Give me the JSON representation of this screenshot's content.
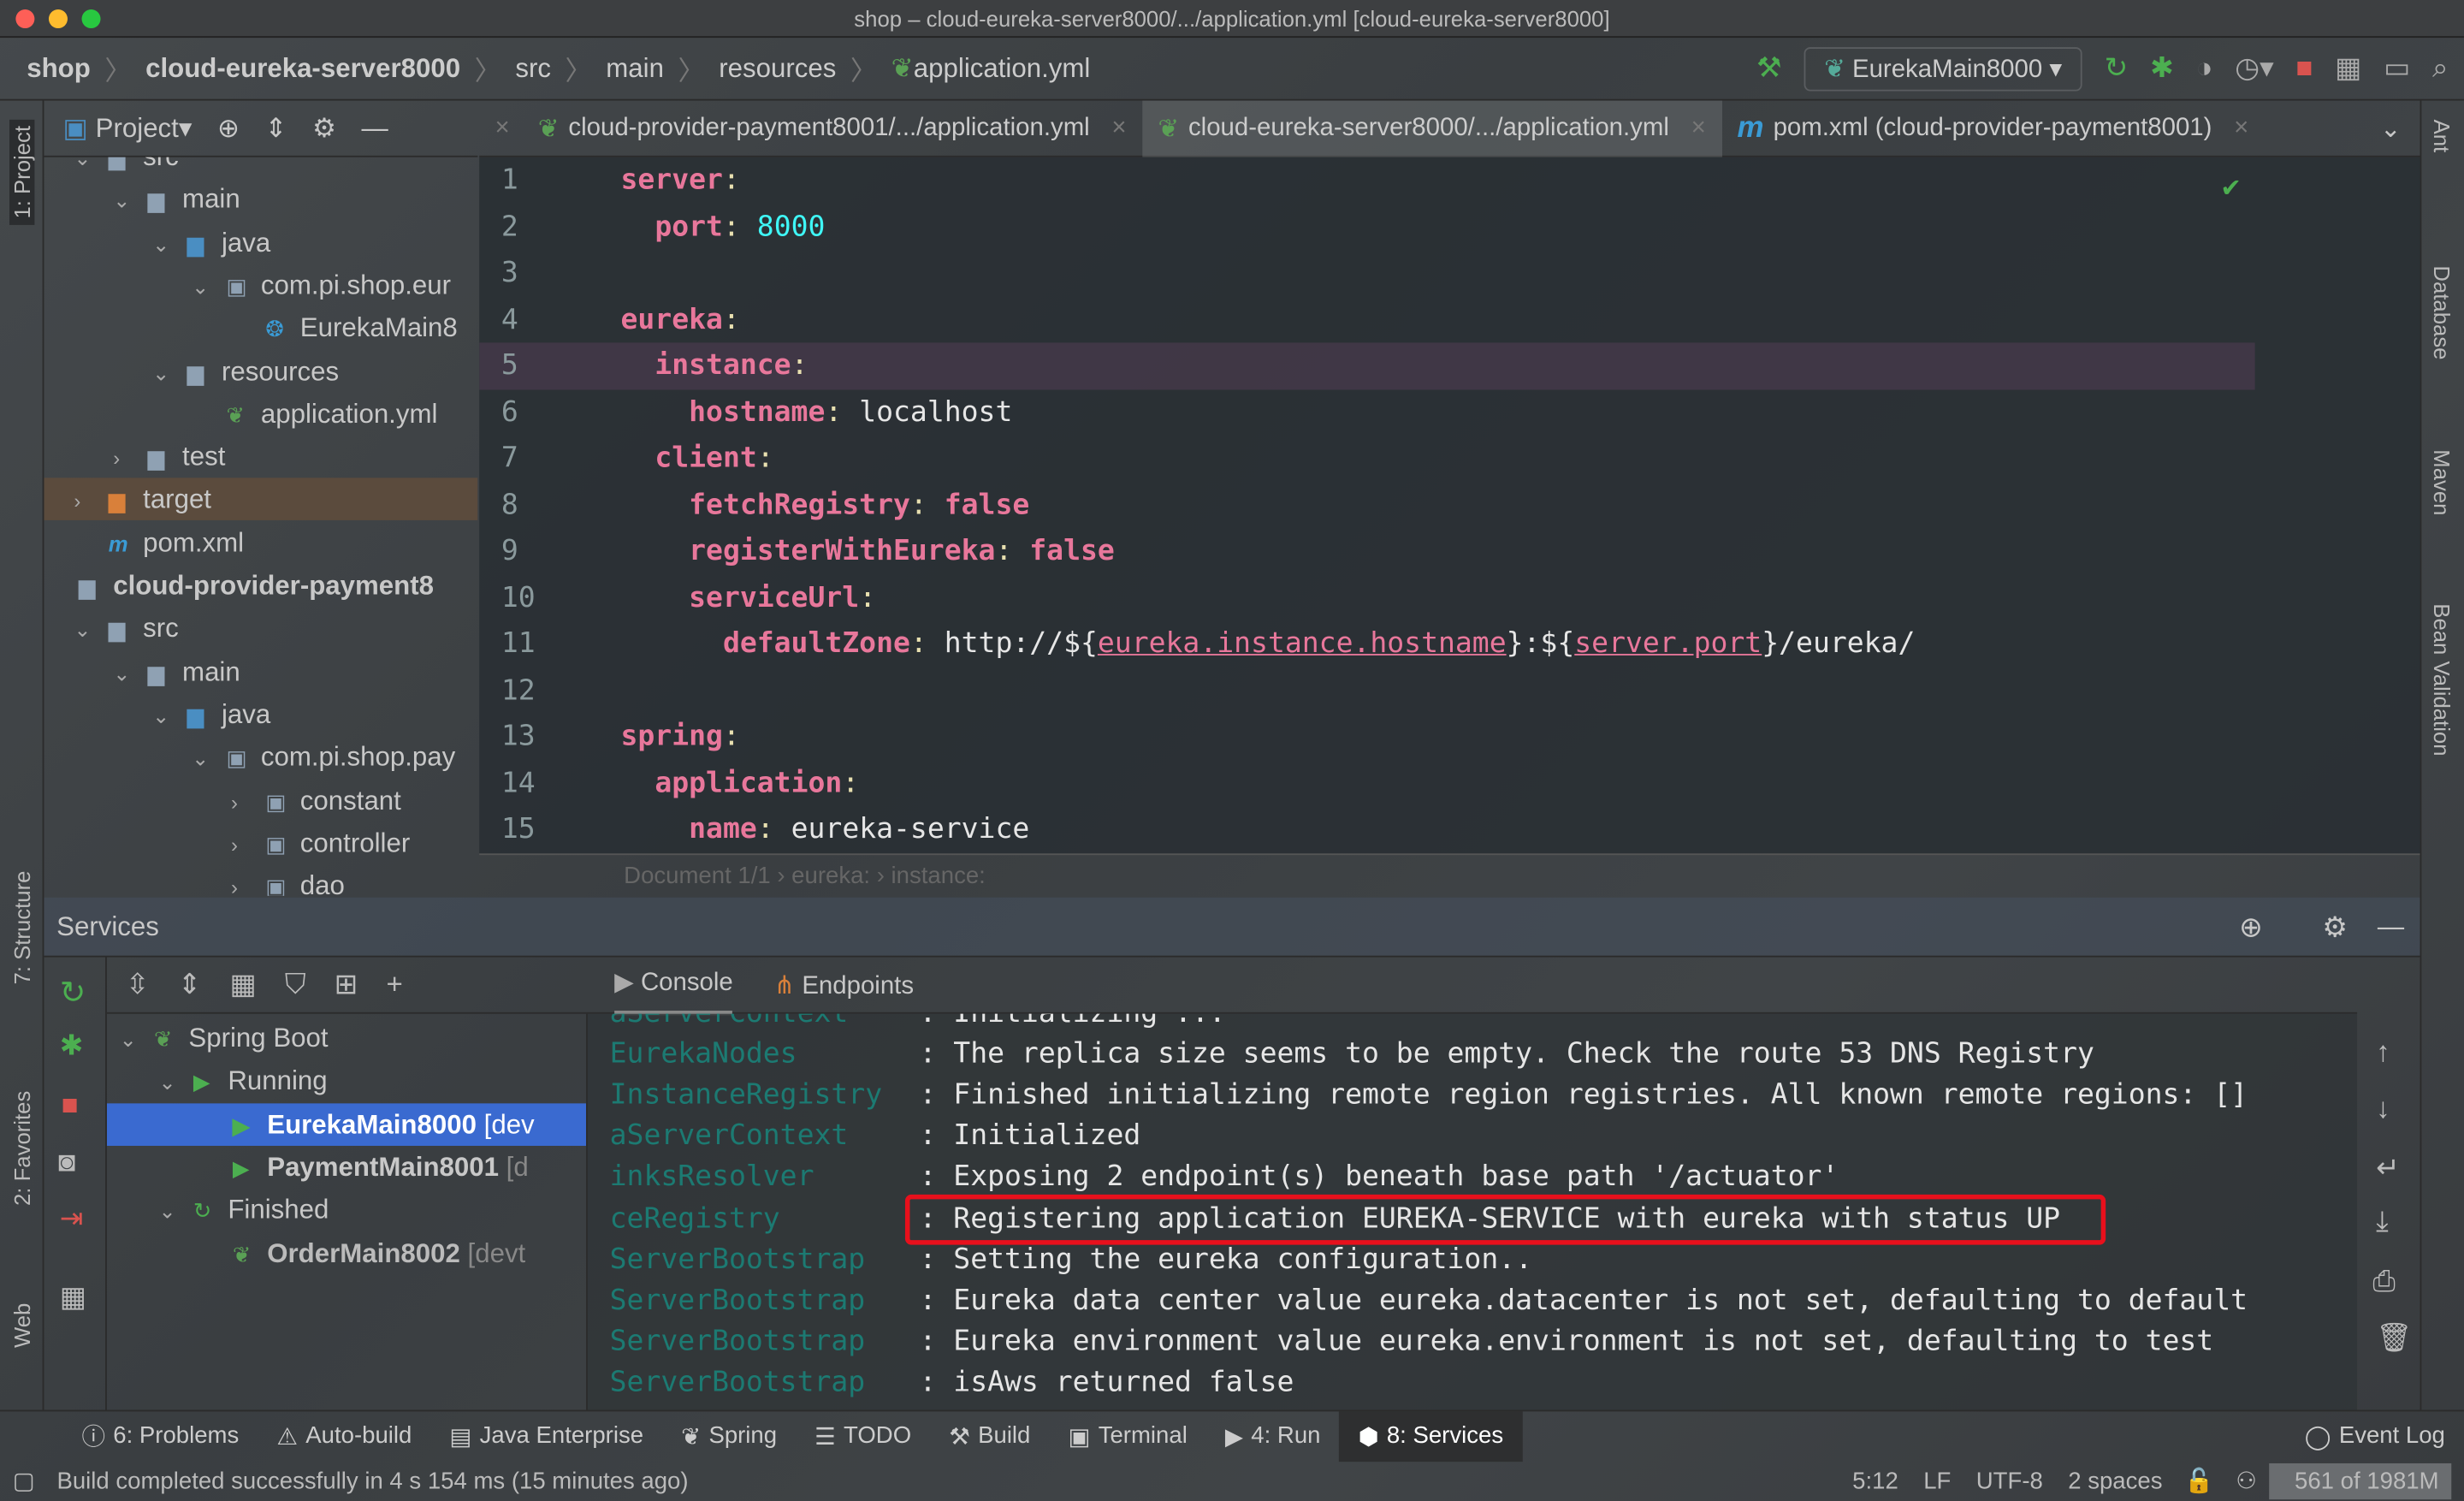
{
  "window": {
    "title": "shop – cloud-eureka-server8000/.../application.yml [cloud-eureka-server8000]"
  },
  "navbar": {
    "crumbs": [
      "shop",
      "cloud-eureka-server8000",
      "src",
      "main",
      "resources",
      "application.yml"
    ],
    "run_config": "EurekaMain8000"
  },
  "left_strip": {
    "project": "1: Project",
    "structure": "7: Structure",
    "favorites": "2: Favorites",
    "web": "Web"
  },
  "right_strip": {
    "ant": "Ant",
    "database": "Database",
    "maven": "Maven",
    "bean": "Bean Validation"
  },
  "project": {
    "title": "Project",
    "tree": [
      {
        "label": "src",
        "level": 1,
        "arrow": "down",
        "icon": "folder"
      },
      {
        "label": "main",
        "level": 2,
        "arrow": "down",
        "icon": "folder"
      },
      {
        "label": "java",
        "level": 3,
        "arrow": "down",
        "icon": "folder-blue"
      },
      {
        "label": "com.pi.shop.eur",
        "level": 4,
        "arrow": "down",
        "icon": "package"
      },
      {
        "label": "EurekaMain8",
        "level": 5,
        "arrow": "",
        "icon": "spring-class"
      },
      {
        "label": "resources",
        "level": 3,
        "arrow": "down",
        "icon": "folder"
      },
      {
        "label": "application.yml",
        "level": 4,
        "arrow": "",
        "icon": "spring-yml"
      },
      {
        "label": "test",
        "level": 2,
        "arrow": "right",
        "icon": "folder"
      },
      {
        "label": "target",
        "level": 1,
        "arrow": "right",
        "icon": "folder-orange",
        "selected": true
      },
      {
        "label": "pom.xml",
        "level": 1,
        "arrow": "",
        "icon": "maven"
      },
      {
        "label": "cloud-provider-payment8",
        "level": 0,
        "arrow": "",
        "icon": "module",
        "bold": true
      },
      {
        "label": "src",
        "level": 1,
        "arrow": "down",
        "icon": "folder"
      },
      {
        "label": "main",
        "level": 2,
        "arrow": "down",
        "icon": "folder"
      },
      {
        "label": "java",
        "level": 3,
        "arrow": "down",
        "icon": "folder-blue"
      },
      {
        "label": "com.pi.shop.pay",
        "level": 4,
        "arrow": "down",
        "icon": "package"
      },
      {
        "label": "constant",
        "level": 5,
        "arrow": "right",
        "icon": "package"
      },
      {
        "label": "controller",
        "level": 5,
        "arrow": "right",
        "icon": "package"
      },
      {
        "label": "dao",
        "level": 5,
        "arrow": "right",
        "icon": "package"
      }
    ]
  },
  "tabs": [
    {
      "label": "cloud-provider-payment8001/.../application.yml",
      "icon": "spring-yml"
    },
    {
      "label": "cloud-eureka-server8000/.../application.yml",
      "icon": "spring-yml",
      "active": true
    },
    {
      "label": "pom.xml (cloud-provider-payment8001)",
      "icon": "maven"
    }
  ],
  "editor": {
    "current_line": 5,
    "lines": [
      [
        [
          "k",
          "server"
        ],
        [
          "c",
          ":"
        ]
      ],
      [
        [
          "t",
          "  "
        ],
        [
          "k",
          "port"
        ],
        [
          "c",
          ": "
        ],
        [
          "n",
          "8000"
        ]
      ],
      [],
      [
        [
          "k",
          "eureka"
        ],
        [
          "c",
          ":"
        ]
      ],
      [
        [
          "t",
          "  "
        ],
        [
          "k",
          "instance"
        ],
        [
          "c",
          ":"
        ]
      ],
      [
        [
          "t",
          "    "
        ],
        [
          "k",
          "hostname"
        ],
        [
          "c",
          ": "
        ],
        [
          "t",
          "localhost"
        ]
      ],
      [
        [
          "t",
          "  "
        ],
        [
          "k",
          "client"
        ],
        [
          "c",
          ":"
        ]
      ],
      [
        [
          "t",
          "    "
        ],
        [
          "k",
          "fetchRegistry"
        ],
        [
          "c",
          ": "
        ],
        [
          "k",
          "false"
        ]
      ],
      [
        [
          "t",
          "    "
        ],
        [
          "k",
          "registerWithEureka"
        ],
        [
          "c",
          ": "
        ],
        [
          "k",
          "false"
        ]
      ],
      [
        [
          "t",
          "    "
        ],
        [
          "k",
          "serviceUrl"
        ],
        [
          "c",
          ":"
        ]
      ],
      [
        [
          "t",
          "      "
        ],
        [
          "k",
          "defaultZone"
        ],
        [
          "c",
          ": "
        ],
        [
          "t",
          "http://${"
        ],
        [
          "u",
          "eureka.instance.hostname"
        ],
        [
          "t",
          "}:${"
        ],
        [
          "u",
          "server.port"
        ],
        [
          "t",
          "}/eureka/"
        ]
      ],
      [],
      [
        [
          "k",
          "spring"
        ],
        [
          "c",
          ":"
        ]
      ],
      [
        [
          "t",
          "  "
        ],
        [
          "k",
          "application"
        ],
        [
          "c",
          ":"
        ]
      ],
      [
        [
          "t",
          "    "
        ],
        [
          "k",
          "name"
        ],
        [
          "c",
          ": "
        ],
        [
          "t",
          "eureka-service"
        ]
      ]
    ]
  },
  "editor_breadcrumb": "Document 1/1  ›  eureka:  ›  instance:",
  "services": {
    "title": "Services",
    "tree": [
      {
        "label": "Spring Boot",
        "level": 0,
        "arrow": "down",
        "icon": "spring"
      },
      {
        "label": "Running",
        "level": 1,
        "arrow": "down",
        "icon": "run"
      },
      {
        "label": "EurekaMain8000",
        "suffix": " [dev",
        "level": 2,
        "icon": "run",
        "selected": true
      },
      {
        "label": "PaymentMain8001",
        "suffix": " [d",
        "level": 2,
        "icon": "run"
      },
      {
        "label": "Finished",
        "level": 1,
        "arrow": "down",
        "icon": "rerun"
      },
      {
        "label": "OrderMain8002",
        "suffix": " [devt",
        "level": 2,
        "icon": "spring"
      }
    ],
    "console_tabs": [
      "Console",
      "Endpoints"
    ],
    "log": [
      {
        "cls": "aServerContext",
        "msg": "Initializing ..."
      },
      {
        "cls": "EurekaNodes",
        "msg": "The replica size seems to be empty. Check the route 53 DNS Registry"
      },
      {
        "cls": "InstanceRegistry",
        "msg": "Finished initializing remote region registries. All known remote regions: []"
      },
      {
        "cls": "aServerContext",
        "msg": "Initialized"
      },
      {
        "cls": "inksResolver",
        "msg": "Exposing 2 endpoint(s) beneath base path '/actuator'"
      },
      {
        "cls": "ceRegistry",
        "msg": "Registering application EUREKA-SERVICE with eureka with status UP",
        "highlight": true
      },
      {
        "cls": "ServerBootstrap",
        "msg": "Setting the eureka configuration.."
      },
      {
        "cls": "ServerBootstrap",
        "msg": "Eureka data center value eureka.datacenter is not set, defaulting to default"
      },
      {
        "cls": "ServerBootstrap",
        "msg": "Eureka environment value eureka.environment is not set, defaulting to test"
      },
      {
        "cls": "ServerBootstrap",
        "msg": "isAws returned false"
      }
    ]
  },
  "bottom_tabs": [
    {
      "label": "6: Problems",
      "icon": "ⓘ"
    },
    {
      "label": "Auto-build",
      "icon": "⚠"
    },
    {
      "label": "Java Enterprise",
      "icon": "▤"
    },
    {
      "label": "Spring",
      "icon": "❦"
    },
    {
      "label": "TODO",
      "icon": "☰"
    },
    {
      "label": "Build",
      "icon": "⚒"
    },
    {
      "label": "Terminal",
      "icon": "▣"
    },
    {
      "label": "4: Run",
      "icon": "▶"
    },
    {
      "label": "8: Services",
      "icon": "⬢",
      "active": true
    }
  ],
  "event_log": "Event Log",
  "status": {
    "message": "Build completed successfully in 4 s 154 ms (15 minutes ago)",
    "position": "5:12",
    "line_sep": "LF",
    "encoding": "UTF-8",
    "indent": "2 spaces",
    "memory": "561 of 1981M"
  },
  "colors": {
    "key": "#e8779b",
    "number": "#3ff6f6",
    "console_class": "#1c7a72",
    "selection": "#3a6ad0",
    "highlight_box": "#e8101c"
  }
}
